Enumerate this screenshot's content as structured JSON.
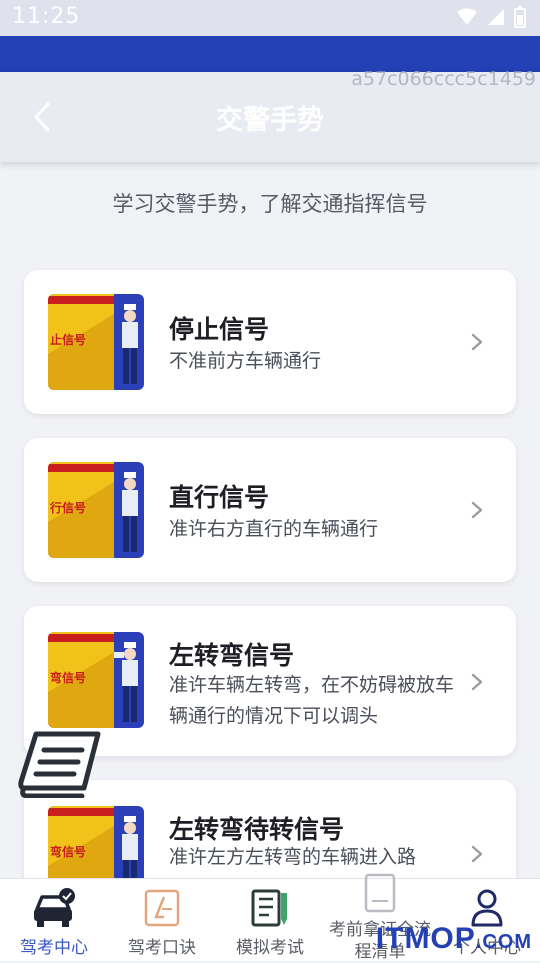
{
  "status_bar": {
    "time": "11:25"
  },
  "watermark_id": "a57c066ccc5c1459",
  "header": {
    "title": "交警手势"
  },
  "intro": "学习交警手势，了解交通指挥信号",
  "signals": [
    {
      "name": "停止信号",
      "description": "不准前方车辆通行",
      "poster_text": "止信号"
    },
    {
      "name": "直行信号",
      "description": "准许右方直行的车辆通行",
      "poster_text": "行信号"
    },
    {
      "name": "左转弯信号",
      "description": "准许车辆左转弯，在不妨碍被放车辆通行的情况下可以调头",
      "poster_text": "弯信号"
    },
    {
      "name": "左转弯待转信号",
      "description": "准许左方左转弯的车辆进入路",
      "poster_text": "弯信号"
    }
  ],
  "tabs": [
    {
      "label": "驾考中心",
      "icon": "car-icon"
    },
    {
      "label": "驾考口诀",
      "icon": "notebook-icon"
    },
    {
      "label": "模拟考试",
      "icon": "book-pen-icon"
    },
    {
      "label": "考前拿证全流程清单",
      "icon": "document-icon"
    },
    {
      "label": "个人中心",
      "icon": "user-icon"
    }
  ],
  "site_logo": {
    "text": "ITMOP",
    "tail": ".COM"
  },
  "colors": {
    "brand_blue": "#2340b4",
    "active_tab": "#3b57c8"
  }
}
